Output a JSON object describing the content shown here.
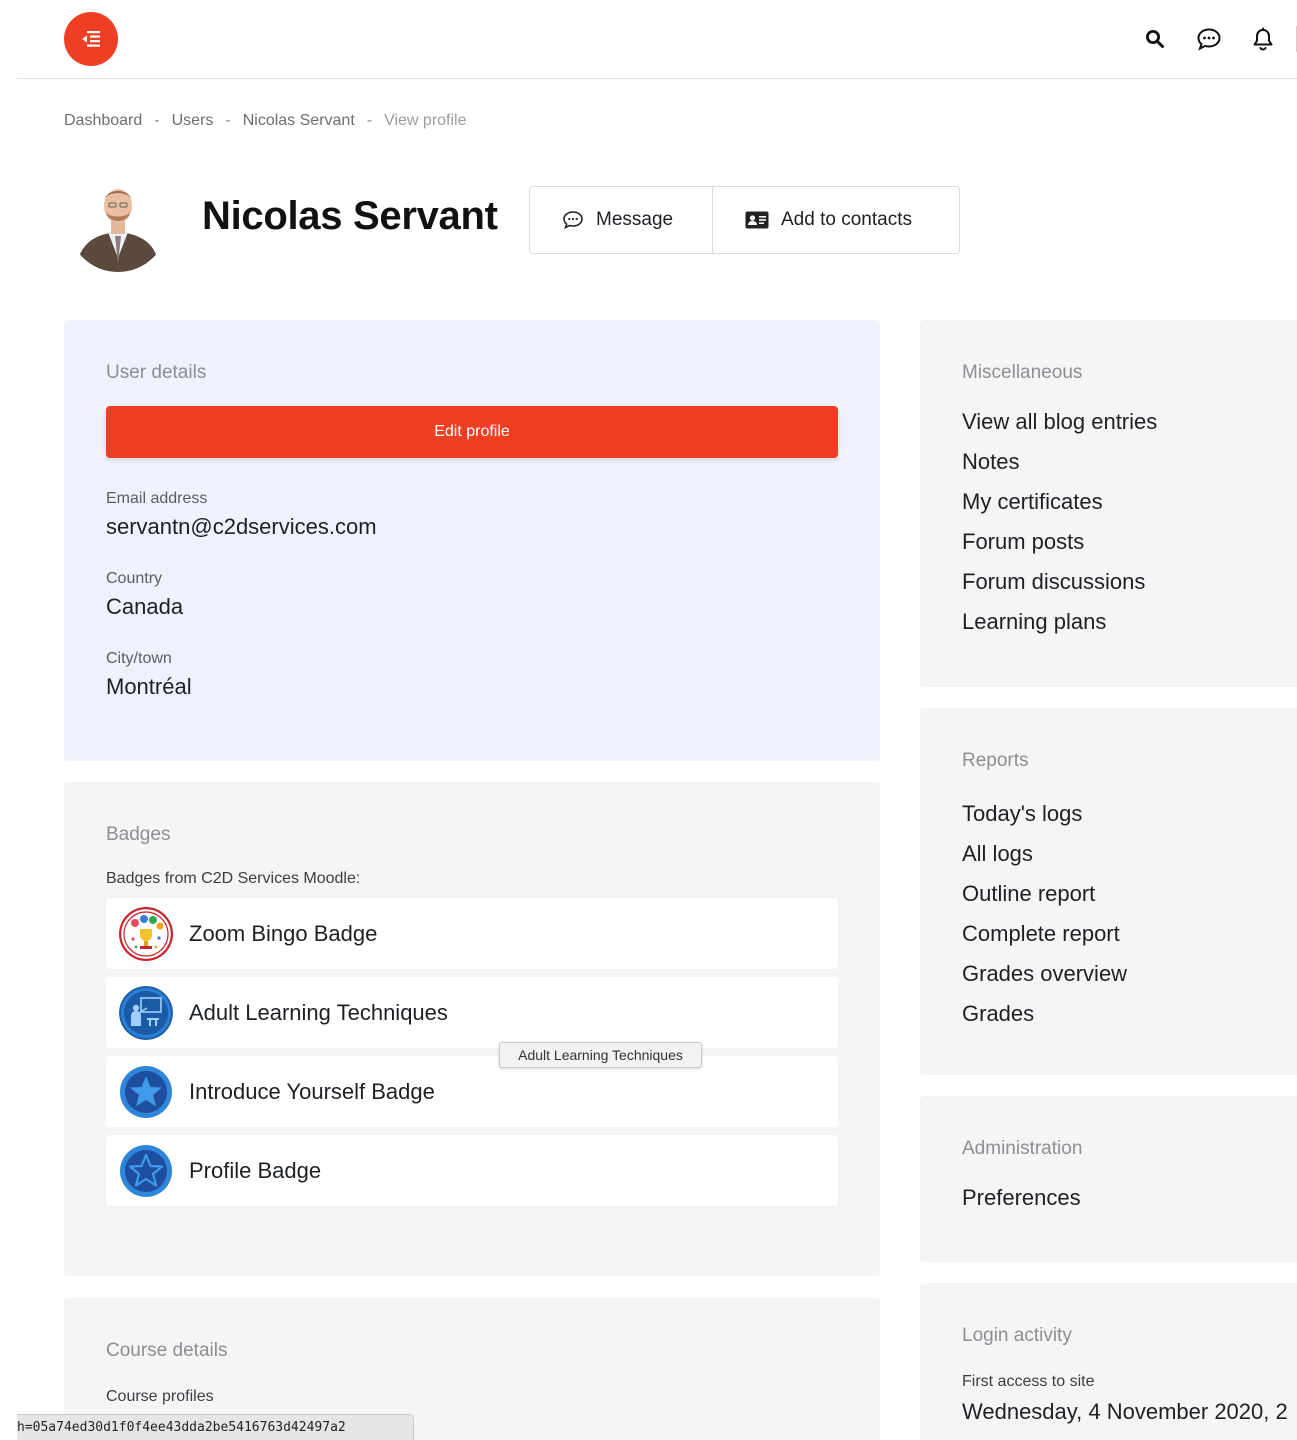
{
  "breadcrumb": {
    "items": [
      "Dashboard",
      "Users",
      "Nicolas Servant"
    ],
    "current": "View profile",
    "separator": "-"
  },
  "profile": {
    "name": "Nicolas Servant",
    "message_label": "Message",
    "contacts_label": "Add to contacts"
  },
  "user_details": {
    "title": "User details",
    "edit_label": "Edit profile",
    "email_label": "Email address",
    "email_value": "servantn@c2dservices.com",
    "country_label": "Country",
    "country_value": "Canada",
    "city_label": "City/town",
    "city_value": "Montréal"
  },
  "badges": {
    "title": "Badges",
    "subtitle": "Badges from C2D Services Moodle:",
    "items": [
      {
        "name": "Zoom Bingo Badge",
        "icon": "bingo-badge-icon"
      },
      {
        "name": "Adult Learning Techniques",
        "icon": "teacher-badge-icon"
      },
      {
        "name": "Introduce Yourself Badge",
        "icon": "star-badge-icon"
      },
      {
        "name": "Profile Badge",
        "icon": "star-outline-badge-icon"
      }
    ],
    "tooltip": "Adult Learning Techniques"
  },
  "course_details": {
    "title": "Course details",
    "subtitle": "Course profiles"
  },
  "miscellaneous": {
    "title": "Miscellaneous",
    "links": [
      "View all blog entries",
      "Notes",
      "My certificates",
      "Forum posts",
      "Forum discussions",
      "Learning plans"
    ]
  },
  "reports": {
    "title": "Reports",
    "links": [
      "Today's logs",
      "All logs",
      "Outline report",
      "Complete report",
      "Grades overview",
      "Grades"
    ]
  },
  "administration": {
    "title": "Administration",
    "links": [
      "Preferences"
    ]
  },
  "login_activity": {
    "title": "Login activity",
    "first_access_label": "First access to site",
    "first_access_value": "Wednesday, 4 November 2020, 2"
  },
  "status_bar": {
    "url_fragment": "h=05a74ed30d1f0f4ee43dda2be5416763d42497a2"
  },
  "colors": {
    "accent": "#ee3f24",
    "user_card_bg": "#eef2fd",
    "card_bg": "#f5f5f5"
  }
}
